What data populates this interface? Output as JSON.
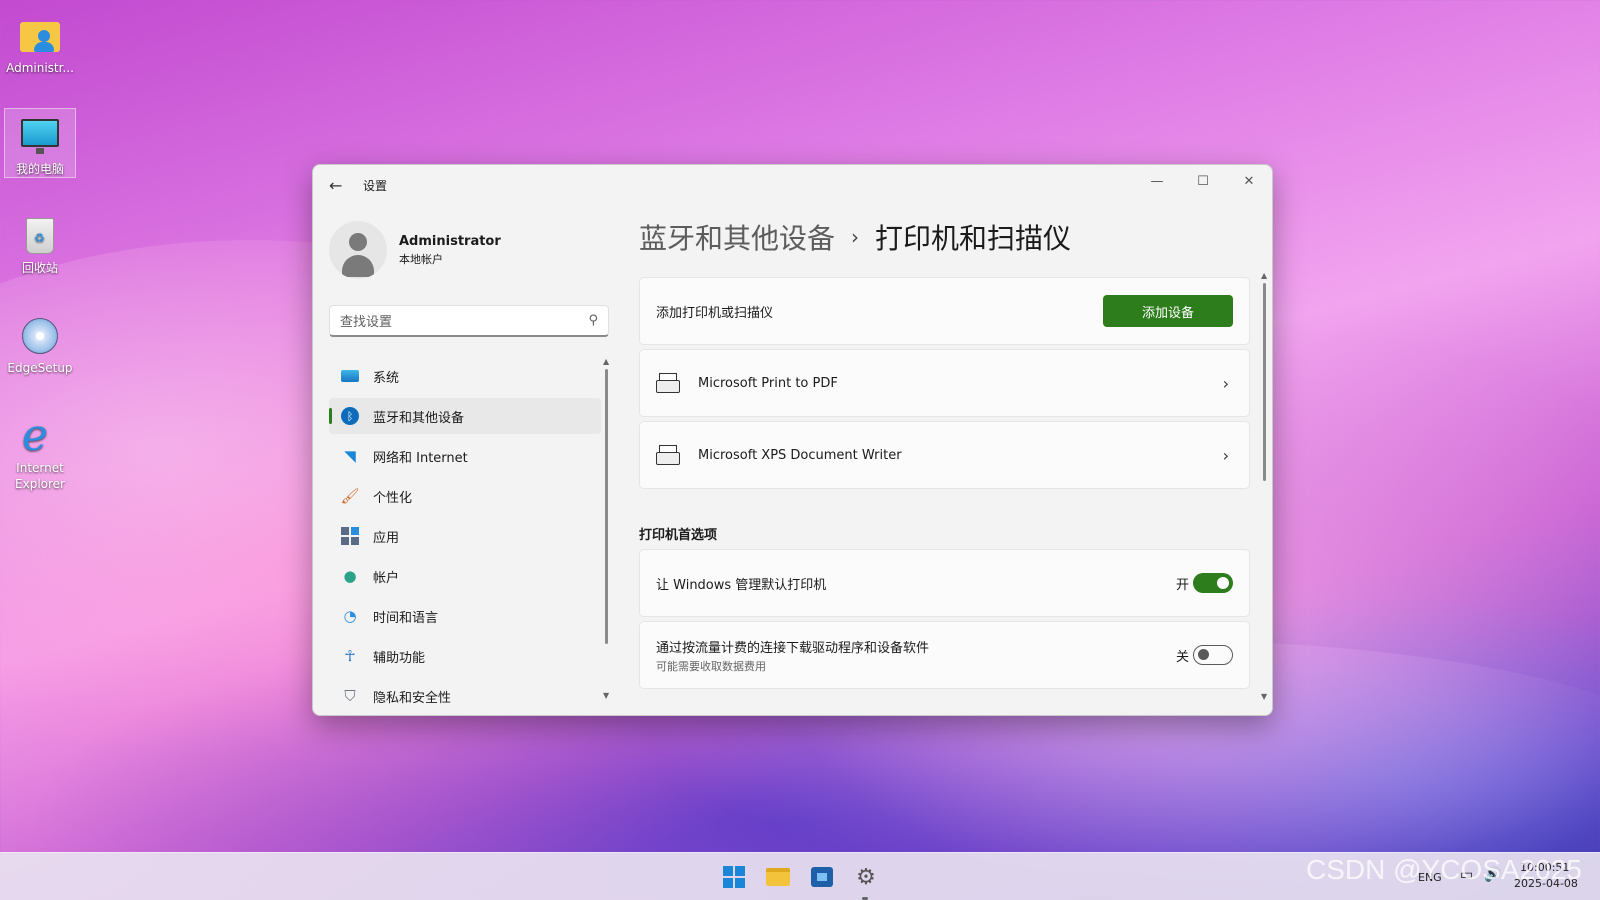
{
  "desktop": {
    "icons": [
      {
        "label": "Administr..."
      },
      {
        "label": "我的电脑"
      },
      {
        "label": "回收站"
      },
      {
        "label": "EdgeSetup"
      },
      {
        "label": "Internet Explorer"
      }
    ]
  },
  "window": {
    "title": "设置",
    "profile": {
      "name": "Administrator",
      "account_type": "本地帐户"
    },
    "search_placeholder": "查找设置",
    "nav": [
      {
        "label": "系统",
        "icon": "monitor-icon"
      },
      {
        "label": "蓝牙和其他设备",
        "icon": "bluetooth-icon",
        "active": true
      },
      {
        "label": "网络和 Internet",
        "icon": "wifi-icon"
      },
      {
        "label": "个性化",
        "icon": "brush-icon"
      },
      {
        "label": "应用",
        "icon": "apps-icon"
      },
      {
        "label": "帐户",
        "icon": "person-icon"
      },
      {
        "label": "时间和语言",
        "icon": "globe-clock-icon"
      },
      {
        "label": "辅助功能",
        "icon": "accessibility-icon"
      },
      {
        "label": "隐私和安全性",
        "icon": "shield-icon"
      }
    ],
    "breadcrumb": {
      "parent": "蓝牙和其他设备",
      "separator": "›",
      "current": "打印机和扫描仪"
    },
    "add_card": {
      "label": "添加打印机或扫描仪",
      "button": "添加设备"
    },
    "printers": [
      {
        "name": "Microsoft Print to PDF"
      },
      {
        "name": "Microsoft XPS Document Writer"
      }
    ],
    "prefs_heading": "打印机首选项",
    "prefs": [
      {
        "label": "让 Windows 管理默认打印机",
        "state_label": "开",
        "on": true
      },
      {
        "label": "通过按流量计费的连接下载驱动程序和设备软件",
        "sublabel": "可能需要收取数据费用",
        "state_label": "关",
        "on": false
      }
    ]
  },
  "tray": {
    "lang": "ENG",
    "time": "10:00:51",
    "date": "2025-04-08"
  },
  "watermark": "CSDN @YCOSA2025",
  "colors": {
    "accent": "#2d7d1c"
  }
}
